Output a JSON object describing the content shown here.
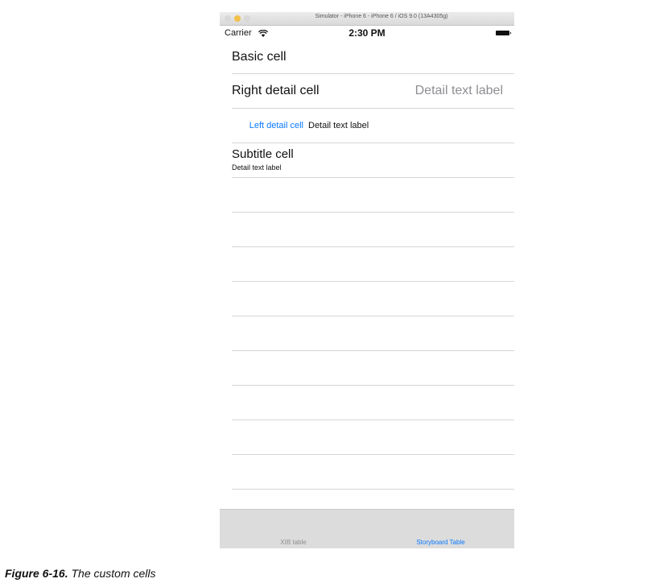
{
  "window": {
    "title": "Simulator - iPhone 6 - iPhone 6 / iOS 9.0 (13A4305g)"
  },
  "status_bar": {
    "carrier": "Carrier",
    "time": "2:30 PM"
  },
  "cells": {
    "basic": {
      "title": "Basic cell"
    },
    "right_detail": {
      "title": "Right detail cell",
      "detail": "Detail text label"
    },
    "left_detail": {
      "title": "Left detail cell",
      "detail": "Detail text label"
    },
    "subtitle": {
      "title": "Subtitle cell",
      "detail": "Detail text label"
    }
  },
  "empty_rows": 9,
  "tab_bar": {
    "tabs": [
      {
        "label": "XIB table",
        "selected": false
      },
      {
        "label": "Storyboard Table",
        "selected": true
      }
    ]
  },
  "caption": {
    "number": "Figure 6-16.",
    "text": "The custom cells"
  },
  "colors": {
    "tint": "#0a7aff",
    "detail_gray": "#8e8e93",
    "separator": "#d6d6d9",
    "tab_bar_bg": "#dcdcdc"
  }
}
